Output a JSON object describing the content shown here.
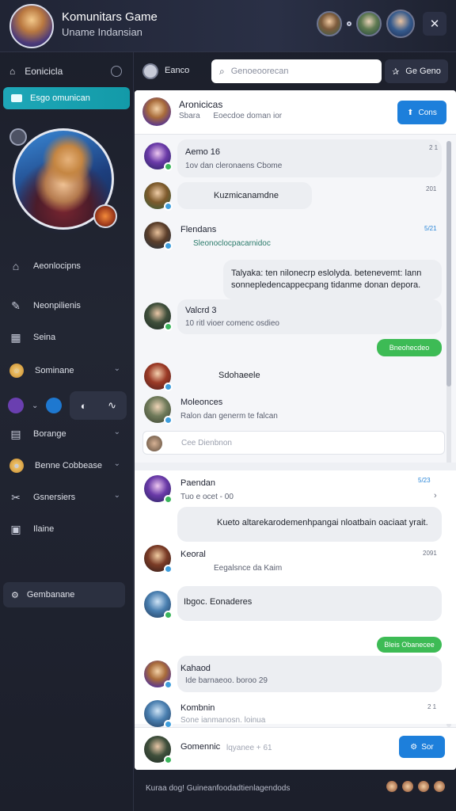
{
  "app": {
    "title": "Komunitars Game",
    "subtitle": "Uname Indansian",
    "close_label": "✕"
  },
  "sidebar": {
    "home_label": "Eonicicla",
    "active_label": "Esgo omunican",
    "nav": [
      {
        "label": "Aeonlocipns",
        "icon": "home-icon"
      },
      {
        "label": "Neonpilienis",
        "icon": "edit-icon"
      },
      {
        "label": "Seina",
        "icon": "grid-icon"
      },
      {
        "label": "Sominane",
        "icon": "user-icon"
      },
      {
        "label": "Borange",
        "icon": "list-icon"
      },
      {
        "label": "Benne Cobbease",
        "icon": "emoji-icon"
      },
      {
        "label": "Gsnersiers",
        "icon": "tools-icon"
      },
      {
        "label": "Ilaine",
        "icon": "image-icon"
      }
    ],
    "bottom_button": "Gembanane"
  },
  "header": {
    "label": "Eanco",
    "search_placeholder": "Genoeoorecan",
    "action_label": "Ge Geno"
  },
  "pinned": {
    "name": "Aronicicas",
    "sub": "Sbara",
    "sub2": "Eoecdoe doman ior",
    "join_label": "Cons"
  },
  "messages": [
    {
      "name": "Aemo 16",
      "text": "1ov dan cleronaens Cbome",
      "time": "2 1"
    },
    {
      "name": "",
      "text": "Kuzmicanamdne",
      "time": "201"
    },
    {
      "name": "Flendans",
      "text": "Sleonoclocpacarnidoc",
      "time": "5/21"
    },
    {
      "name": "",
      "text": "Talyaka: ten nilonecrp eslolyda. betenevemt: lann sonnepledencappecpang tidanme donan depora.",
      "time": ""
    },
    {
      "name": "Valcrd 3",
      "text": "10 ritl vioer comenc osdieo",
      "time": ""
    },
    {
      "name": "",
      "text": "Bneohecdeo",
      "time": ""
    },
    {
      "name": "",
      "text": "Sdohaeele",
      "time": ""
    },
    {
      "name": "Moleonces",
      "text": "Ralon dan generm te falcan",
      "time": ""
    }
  ],
  "compose_placeholder": "Cee Dienbnon",
  "section2": [
    {
      "name": "Paendan",
      "text": "Tuo e ocet - 00",
      "time": "5/23"
    },
    {
      "name": "",
      "text": "Kueto altarekarodemenhpangai nloatbain oaciaat yrait.",
      "time": ""
    },
    {
      "name": "Keoral",
      "text": "Eegalsnce da Kaim",
      "time": "2091"
    },
    {
      "name": "",
      "text": "Ibgoc. Eonaderes",
      "time": ""
    },
    {
      "name": "",
      "text": "Bleis Obanecee",
      "time": ""
    },
    {
      "name": "Kahaod",
      "text": "Ide barnaeoo. boroo 29",
      "time": ""
    },
    {
      "name": "Kombnin",
      "text": "Sone ianmanosn. loinua",
      "time": "2 1"
    }
  ],
  "footer": {
    "name": "Gomennic",
    "hint": "lqyanee +",
    "hint_num": "61",
    "send_label": "Sor"
  },
  "status_bar": "Kuraa dog! Guineanfoodadtienlagendods"
}
